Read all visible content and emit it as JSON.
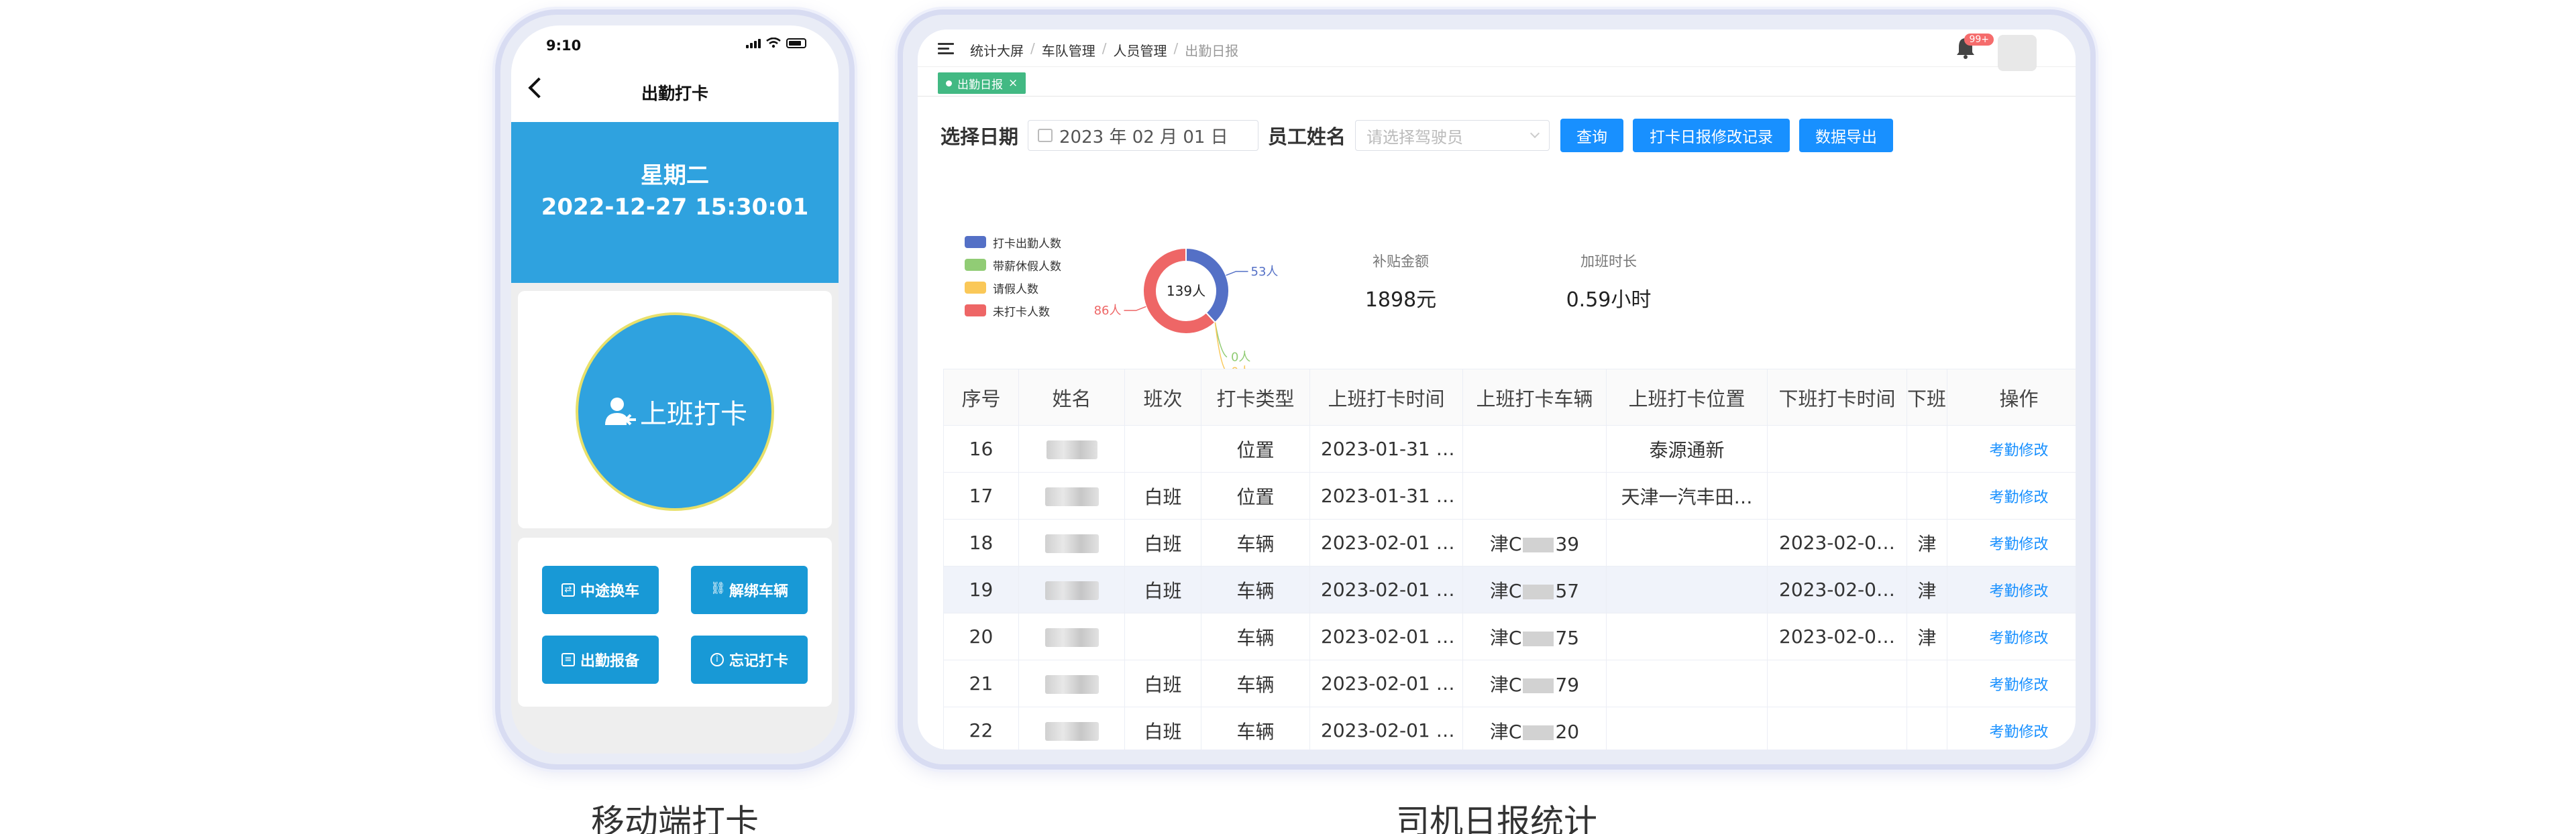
{
  "phone": {
    "status_time": "9:10",
    "nav_title": "出勤打卡",
    "weekday": "星期二",
    "datetime": "2022-12-27 15:30:01",
    "punch_label": "上班打卡",
    "buttons": [
      {
        "label": "中途换车",
        "icon": "swap-icon"
      },
      {
        "label": "解绑车辆",
        "icon": "unlink-icon"
      },
      {
        "label": "出勤报备",
        "icon": "report-icon"
      },
      {
        "label": "忘记打卡",
        "icon": "info-icon"
      }
    ],
    "caption": "移动端打卡"
  },
  "tablet": {
    "breadcrumb": [
      "统计大屏",
      "车队管理",
      "人员管理",
      "出勤日报"
    ],
    "notification_badge": "99+",
    "tab_label": "出勤日报",
    "filter": {
      "date_label": "选择日期",
      "date_value": "2023 年 02 月 01 日",
      "name_label": "员工姓名",
      "name_placeholder": "请选择驾驶员",
      "query_button": "查询",
      "history_button": "打卡日报修改记录",
      "export_button": "数据导出"
    },
    "chart_data": {
      "type": "pie",
      "center_label": "139人",
      "categories": [
        "打卡出勤人数",
        "带薪休假人数",
        "请假人数",
        "未打卡人数"
      ],
      "values": [
        53,
        0,
        0,
        86
      ],
      "value_labels": [
        "53人",
        "0人",
        "0人",
        "86人"
      ],
      "colors": [
        "#5470c6",
        "#91cc75",
        "#fac858",
        "#ee6666"
      ]
    },
    "stats": [
      {
        "key": "补贴金额",
        "value": "1898元"
      },
      {
        "key": "加班时长",
        "value": "0.59小时"
      }
    ],
    "table": {
      "headers": [
        "序号",
        "姓名",
        "班次",
        "打卡类型",
        "上班打卡时间",
        "上班打卡车辆",
        "上班打卡位置",
        "下班打卡时间",
        "下班",
        "操作"
      ],
      "rows": [
        {
          "no": "16",
          "shift": "",
          "type": "位置",
          "on_time": "2023-01-31 …",
          "on_vehicle": "",
          "on_location": "泰源通新",
          "off_time": "",
          "off_cut": "",
          "op": "考勤修改"
        },
        {
          "no": "17",
          "shift": "白班",
          "type": "位置",
          "on_time": "2023-01-31 …",
          "on_vehicle": "",
          "on_location": "天津一汽丰田…",
          "off_time": "",
          "off_cut": "",
          "op": "考勤修改"
        },
        {
          "no": "18",
          "shift": "白班",
          "type": "车辆",
          "on_time": "2023-02-01 …",
          "on_vehicle_pre": "津C",
          "on_vehicle": "39",
          "on_location": "",
          "off_time": "2023-02-0…",
          "off_cut": "津",
          "op": "考勤修改"
        },
        {
          "no": "19",
          "shift": "白班",
          "type": "车辆",
          "on_time": "2023-02-01 …",
          "on_vehicle_pre": "津C",
          "on_vehicle": "57",
          "on_location": "",
          "off_time": "2023-02-0…",
          "off_cut": "津",
          "op": "考勤修改"
        },
        {
          "no": "20",
          "shift": "",
          "type": "车辆",
          "on_time": "2023-02-01 …",
          "on_vehicle_pre": "津C",
          "on_vehicle": "75",
          "on_location": "",
          "off_time": "2023-02-0…",
          "off_cut": "津",
          "op": "考勤修改"
        },
        {
          "no": "21",
          "shift": "白班",
          "type": "车辆",
          "on_time": "2023-02-01 …",
          "on_vehicle_pre": "津C",
          "on_vehicle": "79",
          "on_location": "",
          "off_time": "",
          "off_cut": "",
          "op": "考勤修改"
        },
        {
          "no": "22",
          "shift": "白班",
          "type": "车辆",
          "on_time": "2023-02-01 …",
          "on_vehicle_pre": "津C",
          "on_vehicle": "20",
          "on_location": "",
          "off_time": "",
          "off_cut": "",
          "op": "考勤修改"
        }
      ]
    },
    "caption": "司机日报统计"
  }
}
